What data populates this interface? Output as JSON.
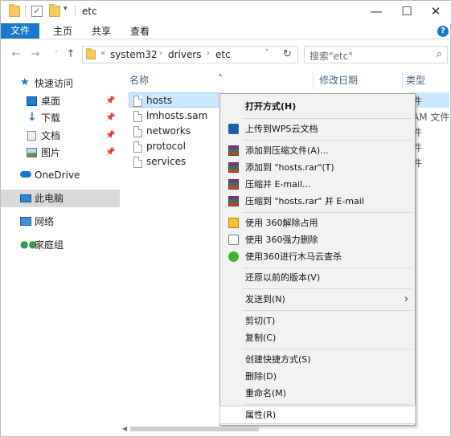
{
  "window": {
    "title": "etc",
    "controls": {
      "minimize": "—",
      "maximize": "☐",
      "close": "✕"
    }
  },
  "ribbon": {
    "tabs": [
      "文件",
      "主页",
      "共享",
      "查看"
    ],
    "help": "?"
  },
  "address": {
    "overflow": "«",
    "crumbs": [
      "system32",
      "drivers",
      "etc"
    ],
    "search_placeholder": "搜索\"etc\""
  },
  "sidebar": {
    "items": [
      {
        "label": "快速访问",
        "icon": "star-icon"
      },
      {
        "label": "桌面",
        "icon": "desktop-icon",
        "pinned": true
      },
      {
        "label": "下载",
        "icon": "download-icon",
        "pinned": true
      },
      {
        "label": "文档",
        "icon": "documents-icon",
        "pinned": true
      },
      {
        "label": "图片",
        "icon": "pictures-icon",
        "pinned": true
      },
      {
        "label": "OneDrive",
        "icon": "cloud-icon"
      },
      {
        "label": "此电脑",
        "icon": "computer-icon",
        "selected": true
      },
      {
        "label": "网络",
        "icon": "network-icon"
      },
      {
        "label": "家庭组",
        "icon": "homegroup-icon"
      }
    ]
  },
  "columns": {
    "name": "名称",
    "date": "修改日期",
    "type": "类型"
  },
  "files": [
    {
      "name": "hosts",
      "type_fragment": "件",
      "selected": true
    },
    {
      "name": "lmhosts.sam",
      "type_fragment": "AM 文件"
    },
    {
      "name": "networks",
      "type_fragment": "件"
    },
    {
      "name": "protocol",
      "type_fragment": "件"
    },
    {
      "name": "services",
      "type_fragment": "件"
    }
  ],
  "context_menu": {
    "open_with": "打开方式(H)",
    "upload_wps": "上传到WPS云文档",
    "add_archive": "添加到压缩文件(A)...",
    "add_hosts_rar": "添加到 \"hosts.rar\"(T)",
    "compress_email": "压缩并 E-mail...",
    "compress_hosts_email": "压缩到 \"hosts.rar\" 并 E-mail",
    "unlock_360": "使用 360解除占用",
    "force_delete_360": "使用 360强力删除",
    "trojan_scan_360": "使用360进行木马云查杀",
    "restore_versions": "还原以前的版本(V)",
    "send_to": "发送到(N)",
    "cut": "剪切(T)",
    "copy": "复制(C)",
    "create_shortcut": "创建快捷方式(S)",
    "delete": "删除(D)",
    "rename": "重命名(M)",
    "properties": "属性(R)"
  }
}
